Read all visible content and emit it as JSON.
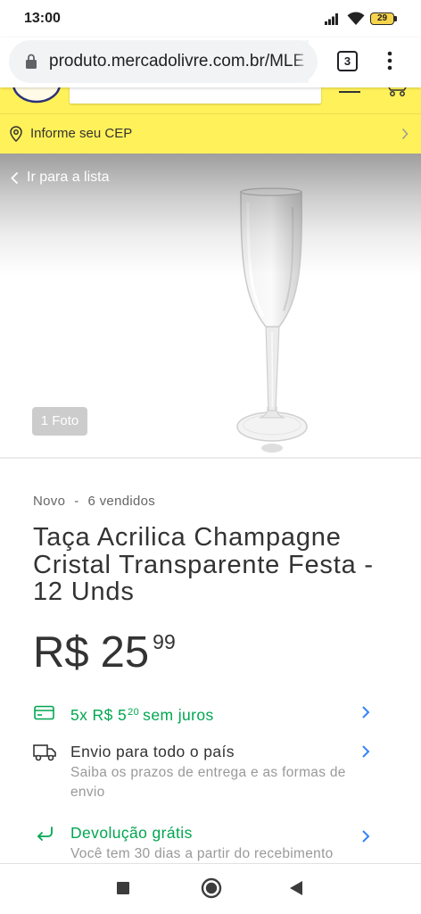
{
  "status_bar": {
    "time": "13:00",
    "battery": "29"
  },
  "browser": {
    "url": "produto.mercadolivre.com.br/MLE",
    "tab_count": "3"
  },
  "location": {
    "cep_label": "Informe seu CEP"
  },
  "gallery": {
    "back_label": "Ir para a lista",
    "photo_count": "1 Foto"
  },
  "product": {
    "condition": "Novo",
    "separator": "-",
    "sold": "6 vendidos",
    "title": "Taça Acrilica Champagne Cristal Transparente Festa - 12 Unds",
    "price": {
      "currency": "R$",
      "amount": "25",
      "cents": "99"
    },
    "installments": {
      "prefix": "5x R$ 5",
      "cents": "20",
      "suffix": "sem juros"
    },
    "shipping": {
      "title": "Envio para todo o país",
      "subtitle": "Saiba os prazos de entrega e as formas de envio"
    },
    "returns": {
      "title": "Devolução grátis",
      "subtitle": "Você tem 30 dias a partir do recebimento"
    }
  },
  "theme": {
    "header_yellow": "#fff159",
    "accent_blue": "#3483fa",
    "success_green": "#00a650",
    "text_dark": "#333333",
    "text_muted": "#999999"
  },
  "icons": {
    "installments": "credit-card-icon",
    "shipping": "truck-icon",
    "returns": "return-arrow-icon",
    "location": "location-pin-icon"
  }
}
